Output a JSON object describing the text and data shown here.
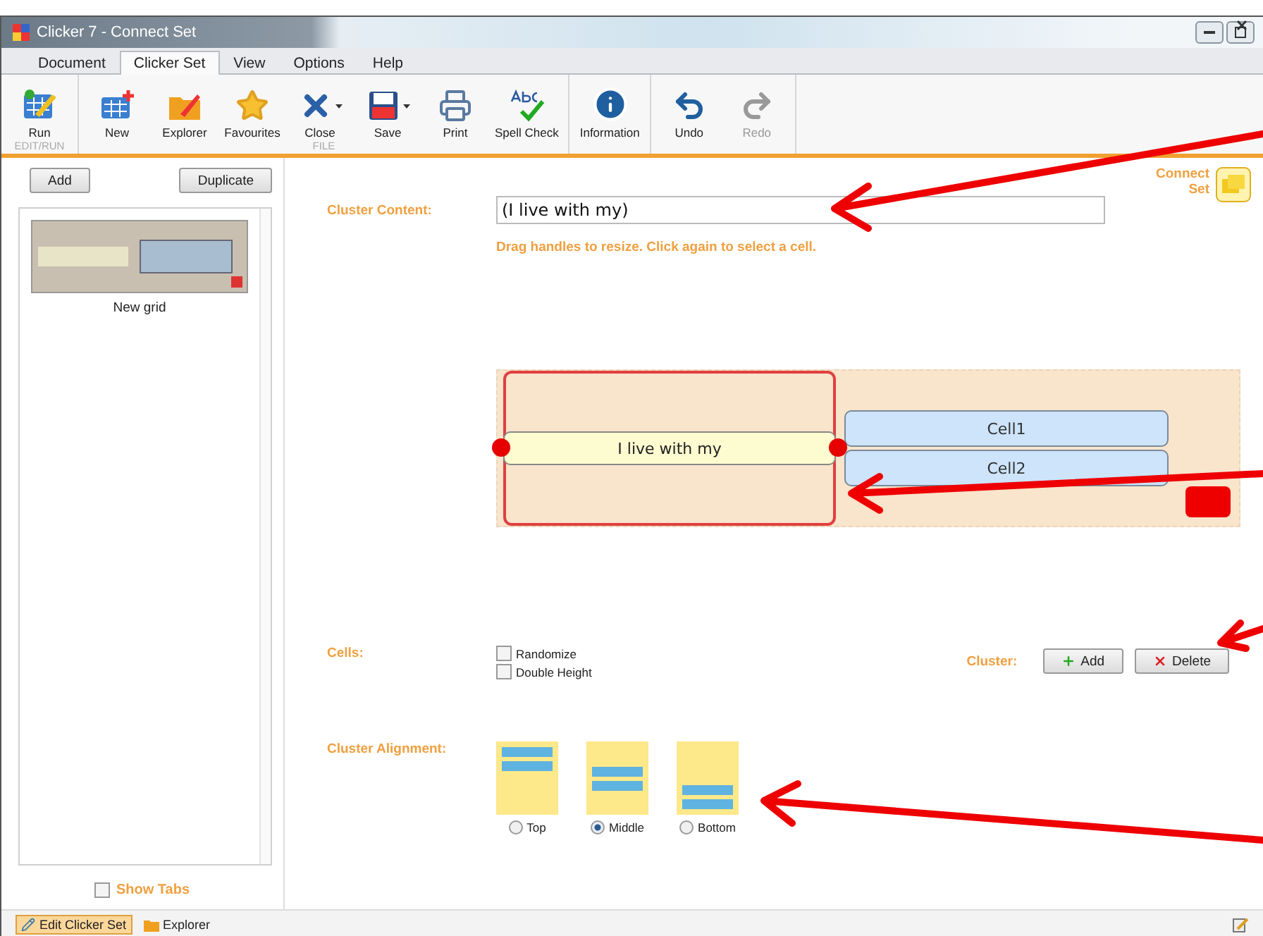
{
  "window": {
    "title": "Clicker 7 - Connect Set"
  },
  "menu_tabs": [
    {
      "label": "Document",
      "selected": false
    },
    {
      "label": "Clicker Set",
      "selected": true
    },
    {
      "label": "View",
      "selected": false
    },
    {
      "label": "Options",
      "selected": false
    },
    {
      "label": "Help",
      "selected": false
    }
  ],
  "ribbon_groups": [
    {
      "label": "EDIT/RUN",
      "buttons": [
        {
          "label": "Run",
          "kind": "run",
          "disabled": false,
          "has_menu": false
        }
      ]
    },
    {
      "label": "FILE",
      "buttons": [
        {
          "label": "New",
          "kind": "new",
          "disabled": false,
          "has_menu": false
        },
        {
          "label": "Explorer",
          "kind": "explorer",
          "disabled": false,
          "has_menu": false
        },
        {
          "label": "Favourites",
          "kind": "favourites",
          "disabled": false,
          "has_menu": false
        },
        {
          "label": "Close",
          "kind": "close",
          "disabled": false,
          "has_menu": true
        },
        {
          "label": "Save",
          "kind": "save",
          "disabled": false,
          "has_menu": true
        },
        {
          "label": "Print",
          "kind": "print",
          "disabled": false,
          "has_menu": false
        },
        {
          "label": "Spell Check",
          "kind": "spell",
          "disabled": false,
          "has_menu": false
        }
      ]
    },
    {
      "buttons": [
        {
          "label": "Information",
          "kind": "info",
          "disabled": false,
          "has_menu": false
        }
      ]
    },
    {
      "buttons": [
        {
          "label": "Undo",
          "kind": "undo",
          "disabled": false,
          "has_menu": false
        },
        {
          "label": "Redo",
          "kind": "redo",
          "disabled": true,
          "has_menu": false
        }
      ]
    }
  ],
  "sidebar": {
    "buttons": [
      "Add",
      "Duplicate"
    ],
    "grids": [
      {
        "name": "New grid",
        "selected": true
      }
    ],
    "show_tabs": {
      "label": "Show Tabs",
      "checked": false
    }
  },
  "editor": {
    "set_type": "Connect Set",
    "cluster_content": {
      "label": "Cluster Content:",
      "value": "(I live with my)"
    },
    "hint": "Drag handles to resize. Click again to select a cell.",
    "preview": {
      "cluster_text": "I live with my",
      "cells": [
        "Cell1",
        "Cell2"
      ]
    },
    "cells": {
      "label": "Cells:",
      "options": [
        {
          "label": "Randomize",
          "checked": false
        },
        {
          "label": "Double Height",
          "checked": false
        }
      ]
    },
    "cluster": {
      "label": "Cluster:",
      "buttons": [
        {
          "label": "Add",
          "kind": "add"
        },
        {
          "label": "Delete",
          "kind": "delete"
        }
      ]
    },
    "alignment": {
      "label": "Cluster Alignment:",
      "options": [
        {
          "label": "Top",
          "kind": "top",
          "selected": false
        },
        {
          "label": "Middle",
          "kind": "middle",
          "selected": true
        },
        {
          "label": "Bottom",
          "kind": "bottom",
          "selected": false
        }
      ]
    }
  },
  "status_bar": {
    "tabs": [
      {
        "label": "Edit Clicker Set",
        "kind": "edit",
        "selected": true
      },
      {
        "label": "Explorer",
        "kind": "explorer",
        "selected": false
      }
    ]
  }
}
